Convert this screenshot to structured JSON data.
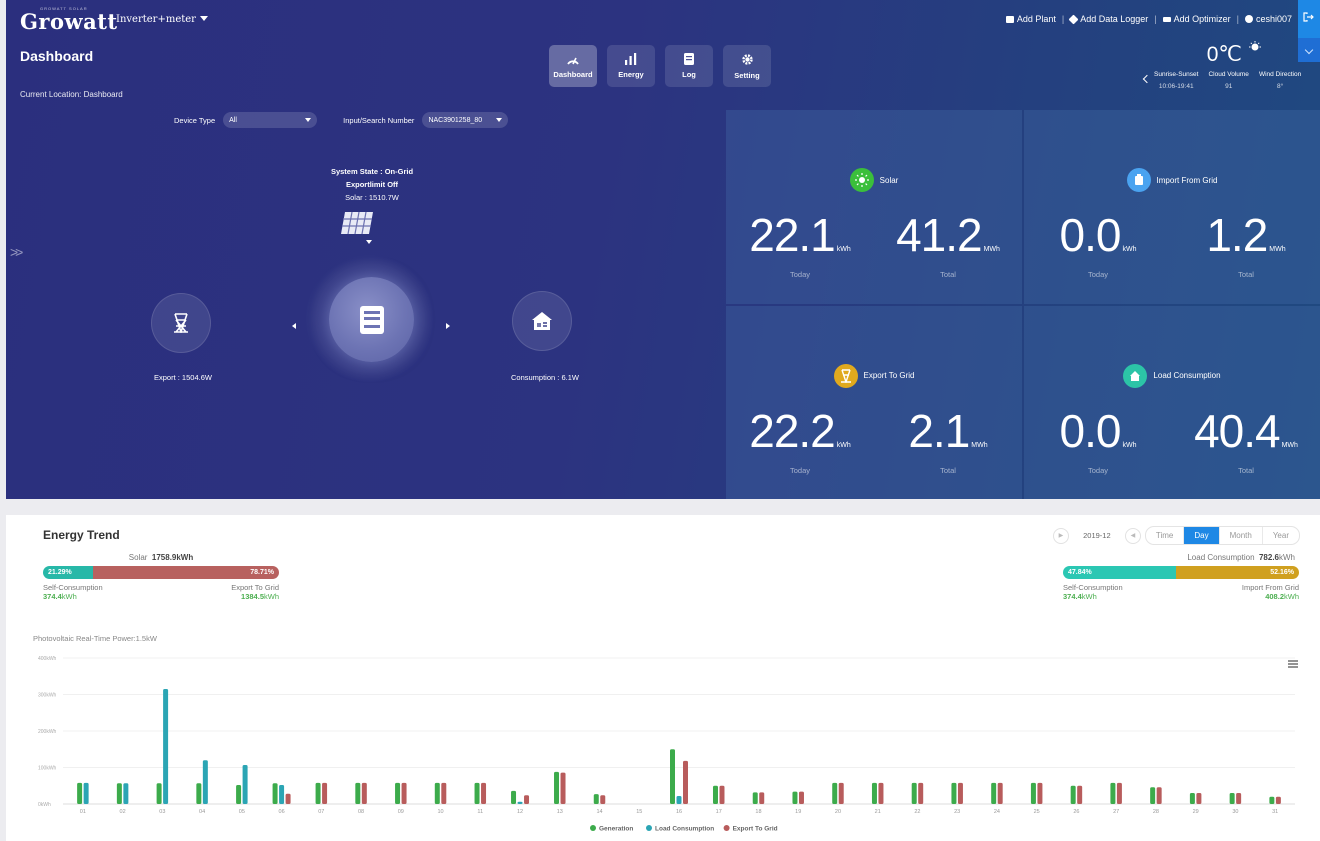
{
  "header": {
    "logo": "Growatt",
    "logo_tag": "GROWATT SOLAR",
    "plant_selector": "Inverter+meter",
    "links": [
      "Add Plant",
      "Add Data Logger",
      "Add Optimizer"
    ],
    "user": "ceshi007"
  },
  "page": {
    "title": "Dashboard",
    "location": "Current Location: Dashboard"
  },
  "nav": [
    {
      "label": "Dashboard",
      "icon": "gauge-icon"
    },
    {
      "label": "Energy",
      "icon": "bar-chart-icon"
    },
    {
      "label": "Log",
      "icon": "log-icon"
    },
    {
      "label": "Setting",
      "icon": "gear-icon"
    }
  ],
  "weather": {
    "temperature": "0℃",
    "sunrise_label": "Sunrise-Sunset",
    "sunrise_value": "10:06-19:41",
    "cloud_label": "Cloud Volume",
    "cloud_value": "91",
    "wind_label": "Wind Direction",
    "wind_value": "8°"
  },
  "filters": {
    "device_type_label": "Device Type",
    "device_type_value": "All",
    "search_label": "Input/Search Number",
    "search_value": "NAC3901258_80"
  },
  "system": {
    "state": "System State : On-Grid",
    "export_limit": "Exportlimit Off",
    "solar": "Solar : 1510.7W",
    "export": "Export : 1504.6W",
    "consumption": "Consumption : 6.1W"
  },
  "tiles": [
    {
      "title": "Solar",
      "color": "#3bbf3b",
      "today": "22.1",
      "today_unit": "kWh",
      "total": "41.2",
      "total_unit": "MWh",
      "today_label": "Today",
      "total_label": "Total"
    },
    {
      "title": "Import From Grid",
      "color": "#4aa3f0",
      "today": "0.0",
      "today_unit": "kWh",
      "total": "1.2",
      "total_unit": "MWh",
      "today_label": "Today",
      "total_label": "Total"
    },
    {
      "title": "Export To Grid",
      "color": "#e0a91e",
      "today": "22.2",
      "today_unit": "kWh",
      "total": "2.1",
      "total_unit": "MWh",
      "today_label": "Today",
      "total_label": "Total"
    },
    {
      "title": "Load Consumption",
      "color": "#2cc4a7",
      "today": "0.0",
      "today_unit": "kWh",
      "total": "40.4",
      "total_unit": "MWh",
      "today_label": "Today",
      "total_label": "Total"
    }
  ],
  "trend": {
    "title": "Energy Trend",
    "date": "2019-12",
    "periods": [
      "Time",
      "Day",
      "Month",
      "Year"
    ],
    "active_period": "Day",
    "solar_summary": {
      "label": "Solar",
      "value": "1758.9",
      "unit": "kWh",
      "left_pct": "21.29%",
      "right_pct": "78.71%",
      "left_fraction": 0.2129,
      "left_label": "Self-Consumption",
      "left_value": "374.4",
      "right_label": "Export To Grid",
      "right_value": "1384.5",
      "value_unit": "kWh"
    },
    "load_summary": {
      "label": "Load Consumption",
      "value": "782.6",
      "unit": "kWh",
      "left_pct": "47.84%",
      "right_pct": "52.16%",
      "left_fraction": 0.4784,
      "left_label": "Self-Consumption",
      "left_value": "374.4",
      "right_label": "Import From Grid",
      "right_value": "408.2",
      "value_unit": "kWh"
    },
    "pv_realtime": "Photovoltaic Real-Time Power:1.5kW"
  },
  "chart_data": {
    "type": "bar",
    "categories": [
      "01",
      "02",
      "03",
      "04",
      "05",
      "06",
      "07",
      "08",
      "09",
      "10",
      "11",
      "12",
      "13",
      "14",
      "15",
      "16",
      "17",
      "18",
      "19",
      "20",
      "21",
      "22",
      "23",
      "24",
      "25",
      "26",
      "27",
      "28",
      "29",
      "30",
      "31"
    ],
    "ylim": [
      0,
      400
    ],
    "yticks": [
      "0kWh",
      "100kWh",
      "200kWh",
      "300kWh",
      "400kWh"
    ],
    "series": [
      {
        "name": "Generation",
        "color": "#3cab4b",
        "values": [
          58,
          57,
          57,
          57,
          52,
          57,
          58,
          58,
          58,
          58,
          58,
          36,
          88,
          27,
          0,
          150,
          50,
          32,
          34,
          58,
          58,
          58,
          58,
          58,
          58,
          50,
          58,
          46,
          30,
          30,
          20
        ]
      },
      {
        "name": "Load Consumption",
        "color": "#2ba5b4",
        "values": [
          58,
          57,
          315,
          120,
          107,
          52,
          0,
          0,
          0,
          0,
          0,
          6,
          0,
          0,
          0,
          22,
          0,
          0,
          0,
          0,
          0,
          0,
          0,
          0,
          0,
          0,
          0,
          0,
          0,
          0,
          0
        ]
      },
      {
        "name": "Export To Grid",
        "color": "#b85c5c",
        "values": [
          0,
          0,
          0,
          0,
          0,
          28,
          58,
          58,
          58,
          58,
          58,
          24,
          86,
          24,
          0,
          118,
          50,
          32,
          34,
          58,
          58,
          58,
          58,
          58,
          58,
          50,
          58,
          46,
          30,
          30,
          20
        ]
      }
    ],
    "legend_position": "bottom"
  }
}
